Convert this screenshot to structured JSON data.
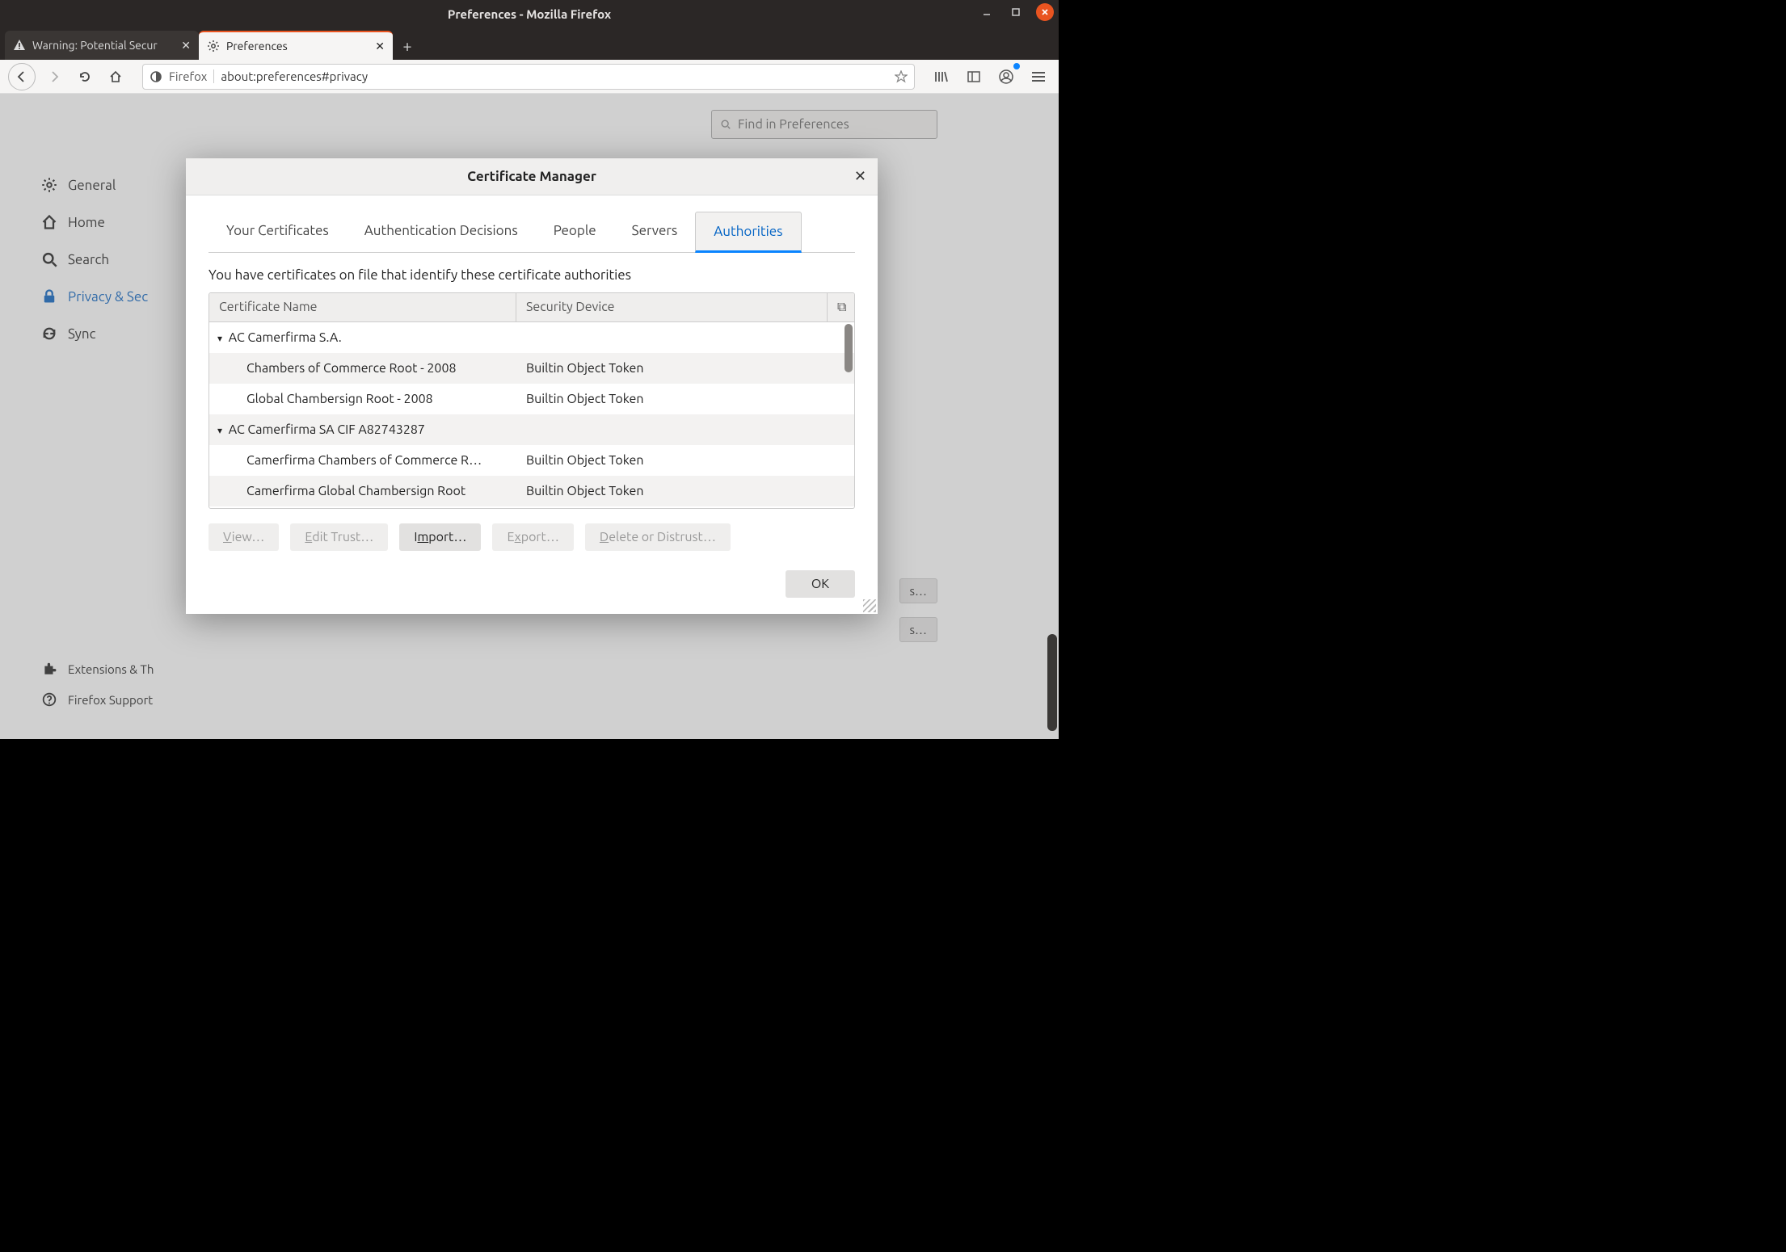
{
  "window": {
    "title": "Preferences - Mozilla Firefox"
  },
  "tabs": [
    {
      "label": "Warning: Potential Secur",
      "active": false
    },
    {
      "label": "Preferences",
      "active": true
    }
  ],
  "urlbar": {
    "brand": "Firefox",
    "url": "about:preferences#privacy"
  },
  "prefs": {
    "find_placeholder": "Find in Preferences",
    "sidebar": {
      "items": [
        {
          "label": "General"
        },
        {
          "label": "Home"
        },
        {
          "label": "Search"
        },
        {
          "label": "Privacy & Sec"
        },
        {
          "label": "Sync"
        }
      ],
      "bottom": [
        {
          "label": "Extensions & Th"
        },
        {
          "label": "Firefox Support"
        }
      ]
    },
    "stub_buttons": [
      "s…",
      "s…"
    ]
  },
  "modal": {
    "title": "Certificate Manager",
    "tabs": [
      "Your Certificates",
      "Authentication Decisions",
      "People",
      "Servers",
      "Authorities"
    ],
    "active_tab": "Authorities",
    "prompt": "You have certificates on file that identify these certificate authorities",
    "columns": [
      "Certificate Name",
      "Security Device"
    ],
    "rows": [
      {
        "type": "group",
        "name": "AC Camerfirma S.A."
      },
      {
        "type": "child",
        "name": "Chambers of Commerce Root - 2008",
        "device": "Builtin Object Token"
      },
      {
        "type": "child",
        "name": "Global Chambersign Root - 2008",
        "device": "Builtin Object Token"
      },
      {
        "type": "group",
        "name": "AC Camerfirma SA CIF A82743287"
      },
      {
        "type": "child",
        "name": "Camerfirma Chambers of Commerce R…",
        "device": "Builtin Object Token"
      },
      {
        "type": "child",
        "name": "Camerfirma Global Chambersign Root",
        "device": "Builtin Object Token"
      }
    ],
    "buttons": {
      "view": "View…",
      "edit": "Edit Trust…",
      "import": "Import…",
      "export": "Export…",
      "delete": "Delete or Distrust…",
      "ok": "OK"
    }
  }
}
